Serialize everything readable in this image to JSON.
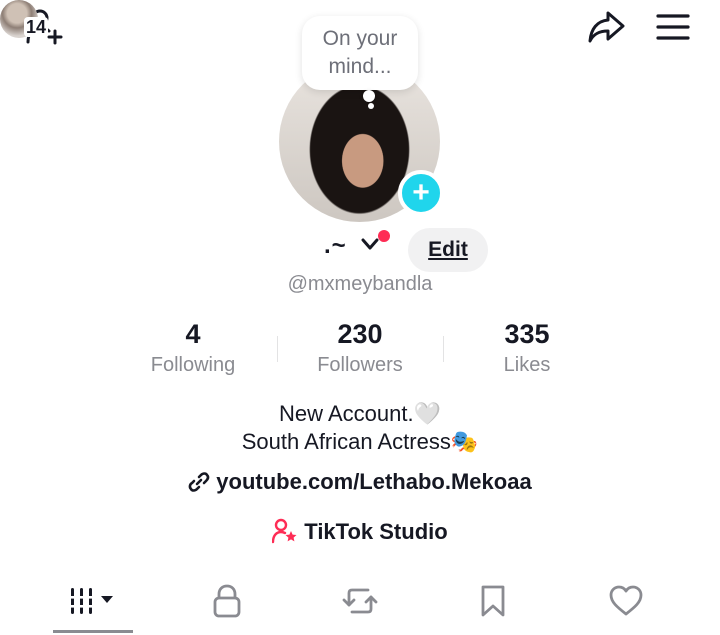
{
  "header": {
    "visitor_count": "14",
    "icons": [
      "add-friend-icon",
      "visitors-avatar",
      "share-icon",
      "menu-icon"
    ]
  },
  "note": {
    "text": "On your mind..."
  },
  "profile": {
    "display_name": ".~",
    "edit_label": "Edit",
    "username": "@mxmeybandla",
    "avatar_add_symbol": "+"
  },
  "stats": {
    "following": {
      "value": "4",
      "label": "Following"
    },
    "followers": {
      "value": "230",
      "label": "Followers"
    },
    "likes": {
      "value": "335",
      "label": "Likes"
    }
  },
  "bio": {
    "line1": "New Account.🤍",
    "line2": "South African Actress🎭",
    "link": "youtube.com/Lethabo.Mekoaa",
    "studio": "TikTok Studio"
  },
  "tabs": {
    "icons": [
      "videos-grid-icon",
      "lock-icon",
      "repost-icon",
      "bookmark-icon",
      "heart-icon"
    ],
    "active": "videos"
  },
  "colors": {
    "accent_cyan": "#20d5ec",
    "accent_red": "#fe2c55",
    "text_primary": "#161823",
    "text_secondary": "#8a8b91"
  }
}
